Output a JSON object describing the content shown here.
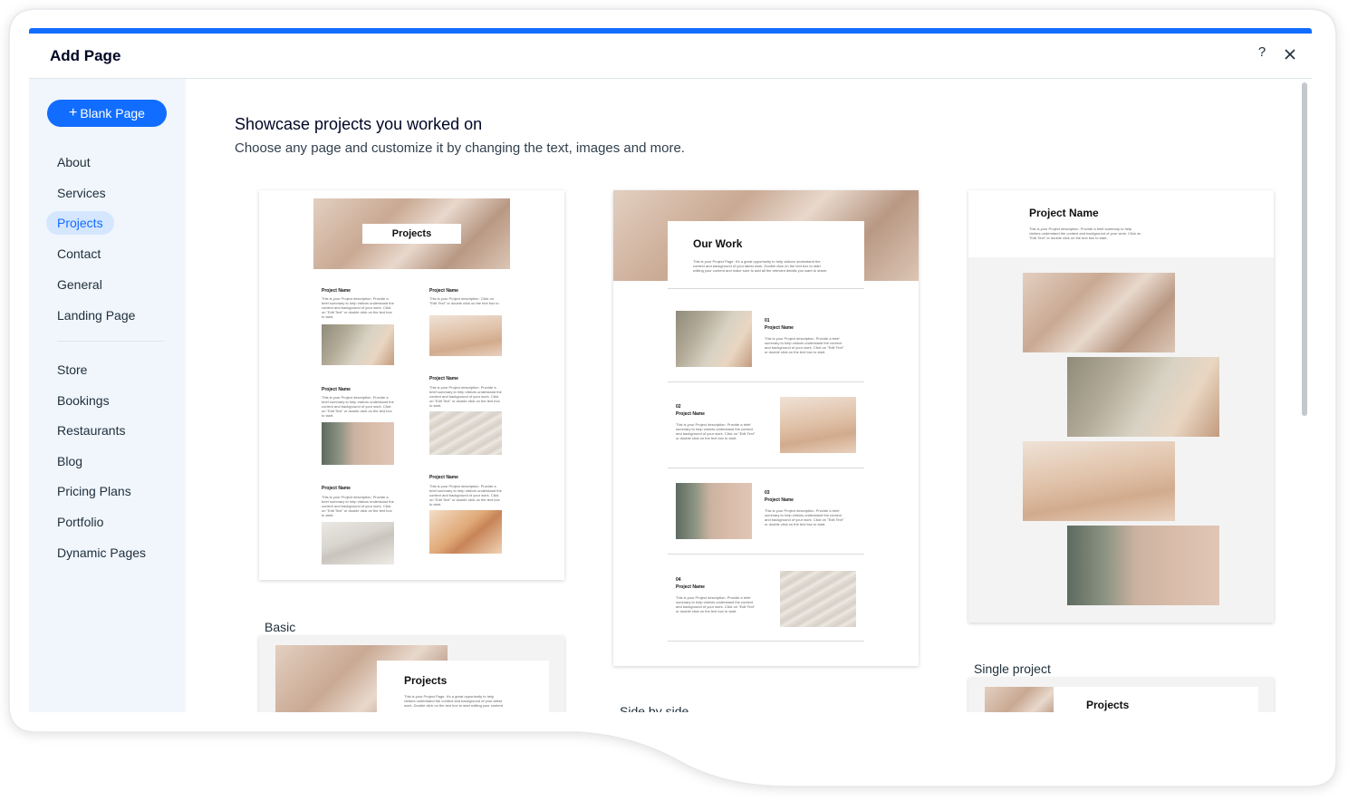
{
  "dialog": {
    "title": "Add Page",
    "help_label": "?",
    "accent_color": "#116dff"
  },
  "sidebar": {
    "blank_button": {
      "icon": "+",
      "label": "Blank Page"
    },
    "items": [
      {
        "label": "About"
      },
      {
        "label": "Services"
      },
      {
        "label": "Projects",
        "selected": true
      },
      {
        "label": "Contact"
      },
      {
        "label": "General"
      },
      {
        "label": "Landing Page"
      },
      {
        "label": "Store"
      },
      {
        "label": "Bookings"
      },
      {
        "label": "Restaurants"
      },
      {
        "label": "Blog"
      },
      {
        "label": "Pricing Plans"
      },
      {
        "label": "Portfolio"
      },
      {
        "label": "Dynamic Pages"
      }
    ]
  },
  "main": {
    "heading": "Showcase projects you worked on",
    "subheading": "Choose any page and customize it by changing the text, images and more.",
    "templates": [
      {
        "label": "Basic",
        "hero_title": "Projects",
        "item_name": "Project Name",
        "item_desc_a": "This is your Project description. Provide a brief summary to help visitors understand the context and background of your work. Click on \"Edit Text\" or double click on the text box to start.",
        "item_desc_b": "This is your Project description. Click on \"Edit Text\" or double click on the text box to start."
      },
      {
        "label": "Side by side",
        "hero_title": "Our Work",
        "hero_desc": "This is your Project Page. It's a great opportunity to help visitors understand the context and background of your latest work. Double click on the text box to start editing your content and make sure to add all the relevant details you want to share.",
        "items": [
          {
            "num": "01",
            "name": "Project Name"
          },
          {
            "num": "02",
            "name": "Project Name"
          },
          {
            "num": "03",
            "name": "Project Name"
          },
          {
            "num": "04",
            "name": "Project Name"
          }
        ],
        "item_desc": "This is your Project description. Provide a brief summary to help visitors understand the context and background of your work. Click on \"Edit Text\" or double click on the text box to start."
      },
      {
        "label": "Single project",
        "title": "Project Name",
        "desc": "This is your Project description. Provide a brief summary to help visitors understand the context and background of your work. Click on \"Edit Text\" or double click on the text box to start."
      },
      {
        "label": "",
        "hero_title": "Projects",
        "hero_desc": "This is your Project Page. It's a great opportunity to help visitors understand the context and background of your latest work. Double click on the text box to start editing your content and make sure to add all the relevant details you want to share."
      },
      {
        "label": "",
        "hero_title": "Projects"
      }
    ]
  }
}
